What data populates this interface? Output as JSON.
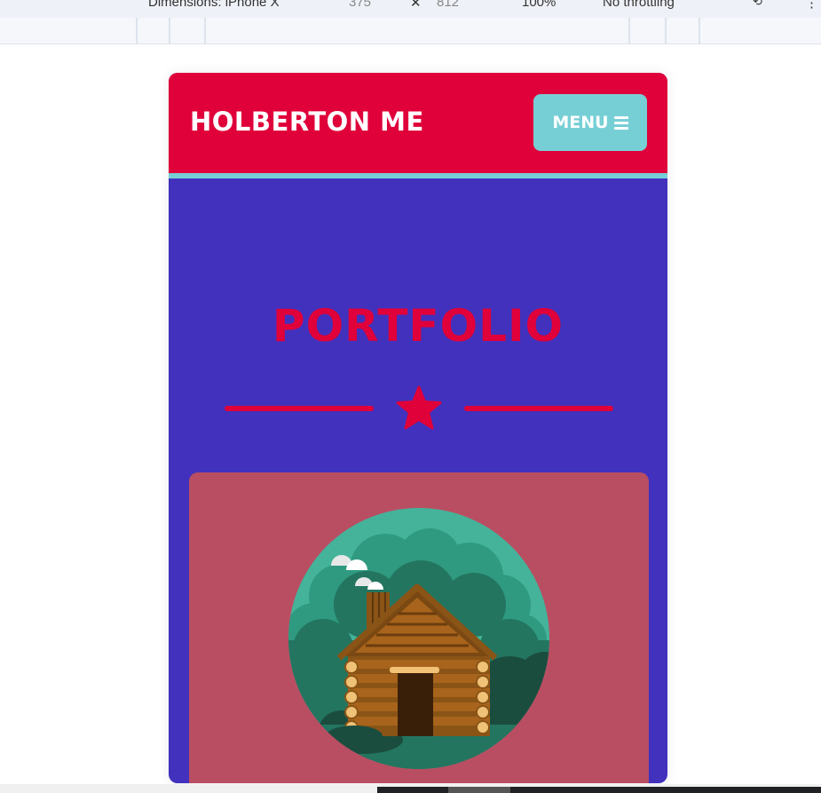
{
  "devtools": {
    "dimensions_label": "Dimensions: iPhone X",
    "width": "375",
    "times": "✕",
    "height": "812",
    "zoom": "100%",
    "throttling": "No throttling",
    "rotate_icon": "rotate-icon",
    "more_icon": "more-icon"
  },
  "header": {
    "brand": "HOLBERTON ME",
    "menu_label": "MENU",
    "menu_icon": "hamburger-icon",
    "accent_color": "#e0003a",
    "border_color": "#77cfd6"
  },
  "portfolio": {
    "title": "PORTFOLIO",
    "divider_icon": "star-icon",
    "background_color": "#4131bd",
    "card": {
      "background_color": "#b94e62",
      "image": "log-cabin-illustration"
    }
  }
}
